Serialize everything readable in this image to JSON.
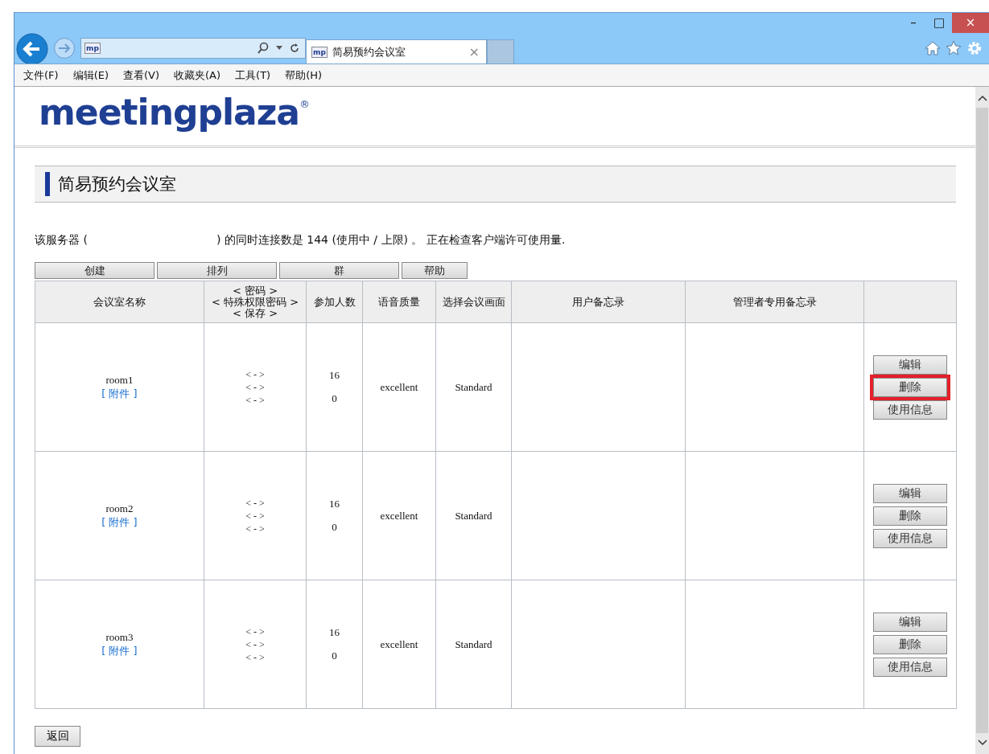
{
  "window": {
    "controls": [
      "–",
      "□",
      "×"
    ]
  },
  "address_bar": {
    "favicon": "mp"
  },
  "tab": {
    "favicon": "mp",
    "title": "简易预约会议室",
    "close": "×"
  },
  "menu": [
    {
      "label": "文件(F)"
    },
    {
      "label": "编辑(E)"
    },
    {
      "label": "查看(V)"
    },
    {
      "label": "收藏夹(A)"
    },
    {
      "label": "工具(T)"
    },
    {
      "label": "帮助(H)"
    }
  ],
  "logo": {
    "text": "meetingplaza",
    "mark": "®"
  },
  "page_title": "简易预约会议室",
  "status_before": "该服务器 (",
  "status_after": ") 的同时连接数是 144 (使用中 / 上限) 。 正在检查客户端许可使用量.",
  "toolbar": [
    "创建",
    "排列",
    "群",
    "帮助"
  ],
  "table": {
    "columns": [
      [
        "会议室名称"
      ],
      [
        "< 密码 >",
        "< 特殊权限密码 >",
        "< 保存 >"
      ],
      [
        "参加人数"
      ],
      [
        "语音质量"
      ],
      [
        "选择会议画面"
      ],
      [
        "用户备忘录"
      ],
      [
        "管理者专用备忘录"
      ],
      []
    ],
    "rows": [
      {
        "name": "room1",
        "attachment": "[ 附件 ]",
        "passwords": [
          "< - >",
          "< - >",
          "< - >"
        ],
        "participants": [
          "16",
          "0"
        ],
        "quality": "excellent",
        "screen": "Standard",
        "actions": [
          {
            "label": "编辑",
            "highlighted": false
          },
          {
            "label": "删除",
            "highlighted": true
          },
          {
            "label": "使用信息",
            "highlighted": false
          }
        ]
      },
      {
        "name": "room2",
        "attachment": "[ 附件 ]",
        "passwords": [
          "< - >",
          "< - >",
          "< - >"
        ],
        "participants": [
          "16",
          "0"
        ],
        "quality": "excellent",
        "screen": "Standard",
        "actions": [
          {
            "label": "编辑",
            "highlighted": false
          },
          {
            "label": "删除",
            "highlighted": false
          },
          {
            "label": "使用信息",
            "highlighted": false
          }
        ]
      },
      {
        "name": "room3",
        "attachment": "[ 附件 ]",
        "passwords": [
          "< - >",
          "< - >",
          "< - >"
        ],
        "participants": [
          "16",
          "0"
        ],
        "quality": "excellent",
        "screen": "Standard",
        "actions": [
          {
            "label": "编辑",
            "highlighted": false
          },
          {
            "label": "删除",
            "highlighted": false
          },
          {
            "label": "使用信息",
            "highlighted": false
          }
        ]
      }
    ]
  },
  "back_button": "返回"
}
